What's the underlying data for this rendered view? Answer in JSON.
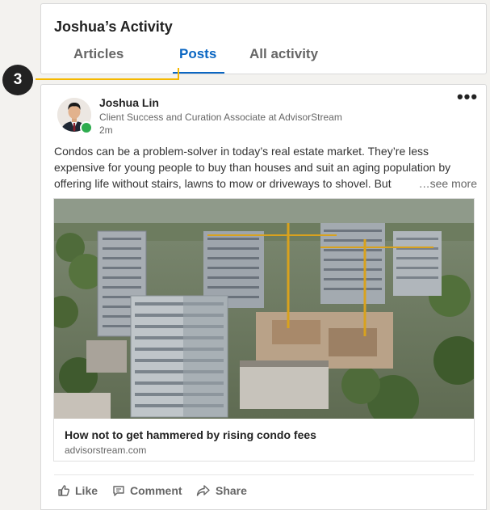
{
  "activity": {
    "title": "Joshua’s Activity",
    "tabs": [
      {
        "label": "Articles",
        "active": false
      },
      {
        "label": "Posts",
        "active": true
      },
      {
        "label": "All activity",
        "active": false
      }
    ]
  },
  "callout": {
    "number": "3",
    "color": "#f5b800"
  },
  "post": {
    "author_name": "Joshua Lin",
    "author_headline": "Client Success and Curation Associate at AdvisorStream",
    "time": "2m",
    "online": true,
    "text_lines": [
      "Condos can be a problem-solver in today’s real estate market. They’re less",
      "expensive for young people to buy than houses and suit an aging population by",
      "offering life without stairs, lawns to mow or driveways to shovel. But "
    ],
    "see_more_label": "…see more",
    "article": {
      "title": "How not to get hammered by rising condo fees",
      "source": "advisorstream.com"
    },
    "actions": {
      "like": "Like",
      "comment": "Comment",
      "share": "Share"
    }
  },
  "colors": {
    "accent": "#0a66c2",
    "presence": "#2eac4e",
    "callout": "#f5b800"
  }
}
